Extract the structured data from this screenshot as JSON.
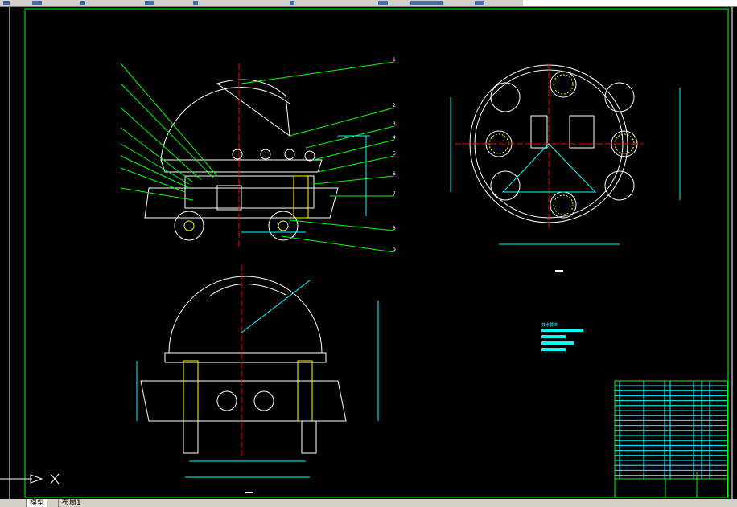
{
  "app": {
    "toolbar_icons": [
      "open-icon",
      "save-icon",
      "print-icon",
      "undo-icon",
      "redo-icon",
      "pan-icon",
      "zoom-icon",
      "layer-icon",
      "properties-icon"
    ]
  },
  "layout_tabs": [
    {
      "label": "模型",
      "active": true
    },
    {
      "label": "布局1",
      "active": false
    }
  ],
  "drawing": {
    "notes_heading": "技术要求",
    "colors": {
      "frame": "#00ff00",
      "dimension": "#00ffff",
      "leader": "#00ff00",
      "outline": "#ffffff",
      "centerline": "#ff0000",
      "hatch": "#ffff00",
      "background": "#000000"
    },
    "ucs_icon": "ucs-axis-icon",
    "leader_numbers_right": [
      "1",
      "2",
      "3",
      "4",
      "5",
      "6",
      "7",
      "8",
      "9"
    ]
  }
}
